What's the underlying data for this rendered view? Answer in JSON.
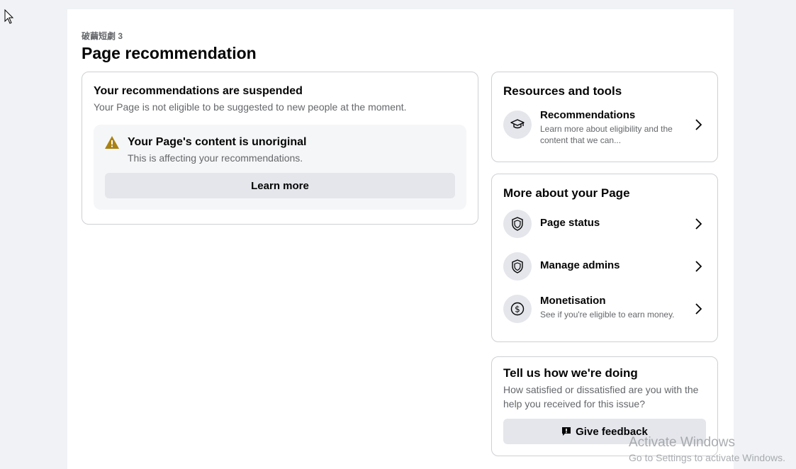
{
  "breadcrumb": "破繭短劇 3",
  "title": "Page recommendation",
  "main": {
    "heading": "Your recommendations are suspended",
    "subtext": "Your Page is not eligible to be suggested to new people at the moment.",
    "warning": {
      "icon": "warning-icon",
      "heading": "Your Page's content is unoriginal",
      "subtext": "This is affecting your recommendations.",
      "button": "Learn more"
    }
  },
  "resources": {
    "heading": "Resources and tools",
    "items": [
      {
        "icon": "graduation-cap-icon",
        "title": "Recommendations",
        "desc": "Learn more about eligibility and the content that we can..."
      }
    ]
  },
  "more": {
    "heading": "More about your Page",
    "items": [
      {
        "icon": "shield-icon",
        "title": "Page status",
        "desc": ""
      },
      {
        "icon": "shield-icon",
        "title": "Manage admins",
        "desc": ""
      },
      {
        "icon": "dollar-icon",
        "title": "Monetisation",
        "desc": "See if you're eligible to earn money."
      }
    ]
  },
  "tell": {
    "heading": "Tell us how we're doing",
    "subtext": "How satisfied or dissatisfied are you with the help you received for this issue?",
    "button": "Give feedback"
  },
  "watermark": {
    "line1": "Activate Windows",
    "line2": "Go to Settings to activate Windows."
  },
  "colors": {
    "warning": "#a98213",
    "button_bg": "#e4e6eb",
    "secondary_text": "#65676b"
  }
}
